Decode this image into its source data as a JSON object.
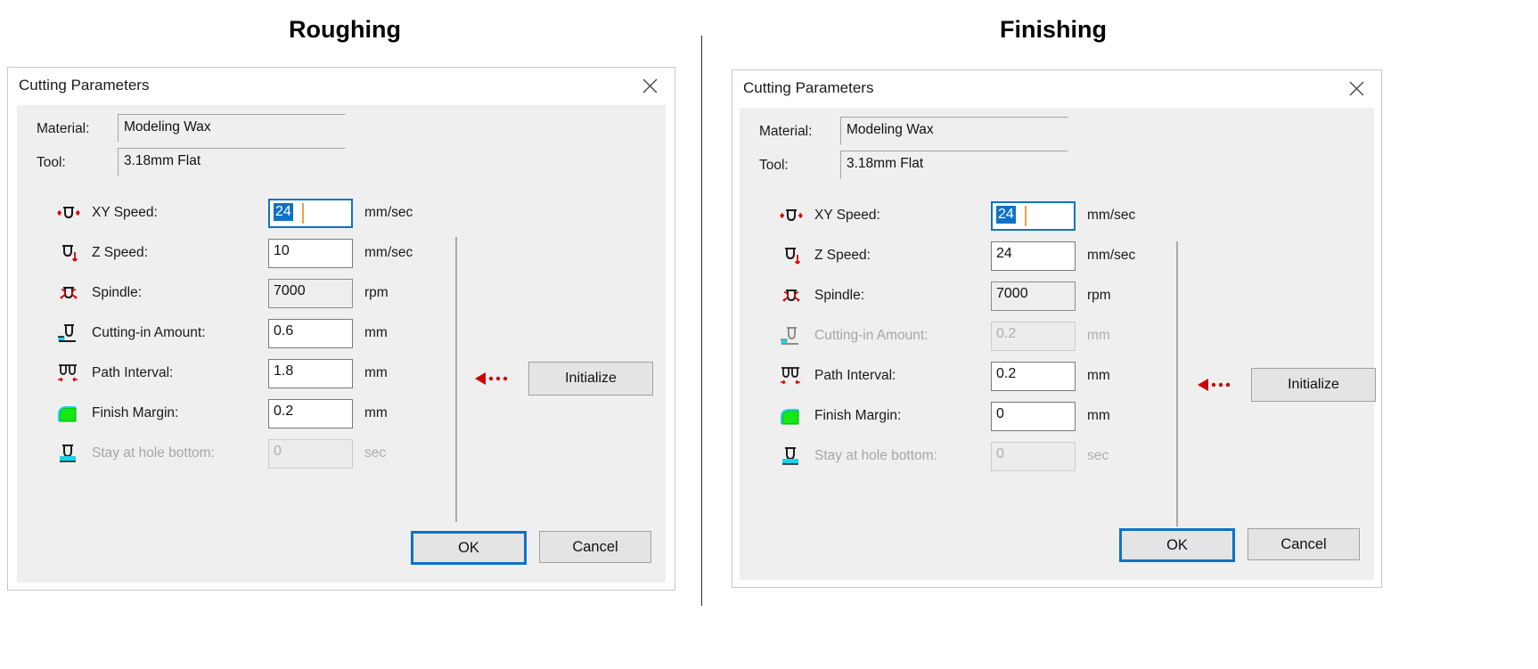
{
  "divider_color": "#2b2b2b",
  "accent_color": "#0f72c4",
  "panels": [
    {
      "heading": "Roughing",
      "dialog": {
        "title": "Cutting Parameters",
        "close_icon": "close-icon",
        "fields": [
          {
            "label": "Material:",
            "value": "Modeling Wax"
          },
          {
            "label": "Tool:",
            "value": "3.18mm Flat"
          }
        ],
        "rows": [
          {
            "icon": "xy-speed-icon",
            "label": "XY Speed:",
            "value": "24",
            "unit": "mm/sec",
            "state": "focused"
          },
          {
            "icon": "z-speed-icon",
            "label": "Z Speed:",
            "value": "10",
            "unit": "mm/sec",
            "state": "normal"
          },
          {
            "icon": "spindle-icon",
            "label": "Spindle:",
            "value": "7000",
            "unit": "rpm",
            "state": "readonly"
          },
          {
            "icon": "cutting-in-icon",
            "label": "Cutting-in Amount:",
            "value": "0.6",
            "unit": "mm",
            "state": "normal"
          },
          {
            "icon": "path-interval-icon",
            "label": "Path Interval:",
            "value": "1.8",
            "unit": "mm",
            "state": "normal"
          },
          {
            "icon": "finish-margin-icon",
            "label": "Finish Margin:",
            "value": "0.2",
            "unit": "mm",
            "state": "normal"
          },
          {
            "icon": "hole-bottom-icon",
            "label": "Stay at hole bottom:",
            "value": "0",
            "unit": "sec",
            "state": "disabled"
          }
        ],
        "initialize_label": "Initialize",
        "ok_label": "OK",
        "cancel_label": "Cancel"
      }
    },
    {
      "heading": "Finishing",
      "dialog": {
        "title": "Cutting Parameters",
        "close_icon": "close-icon",
        "fields": [
          {
            "label": "Material:",
            "value": "Modeling Wax"
          },
          {
            "label": "Tool:",
            "value": "3.18mm Flat"
          }
        ],
        "rows": [
          {
            "icon": "xy-speed-icon",
            "label": "XY Speed:",
            "value": "24",
            "unit": "mm/sec",
            "state": "focused"
          },
          {
            "icon": "z-speed-icon",
            "label": "Z Speed:",
            "value": "24",
            "unit": "mm/sec",
            "state": "normal"
          },
          {
            "icon": "spindle-icon",
            "label": "Spindle:",
            "value": "7000",
            "unit": "rpm",
            "state": "readonly"
          },
          {
            "icon": "cutting-in-icon",
            "label": "Cutting-in Amount:",
            "value": "0.2",
            "unit": "mm",
            "state": "disabled"
          },
          {
            "icon": "path-interval-icon",
            "label": "Path Interval:",
            "value": "0.2",
            "unit": "mm",
            "state": "normal"
          },
          {
            "icon": "finish-margin-icon",
            "label": "Finish Margin:",
            "value": "0",
            "unit": "mm",
            "state": "normal"
          },
          {
            "icon": "hole-bottom-icon",
            "label": "Stay at hole bottom:",
            "value": "0",
            "unit": "sec",
            "state": "disabled"
          }
        ],
        "initialize_label": "Initialize",
        "ok_label": "OK",
        "cancel_label": "Cancel"
      }
    }
  ]
}
